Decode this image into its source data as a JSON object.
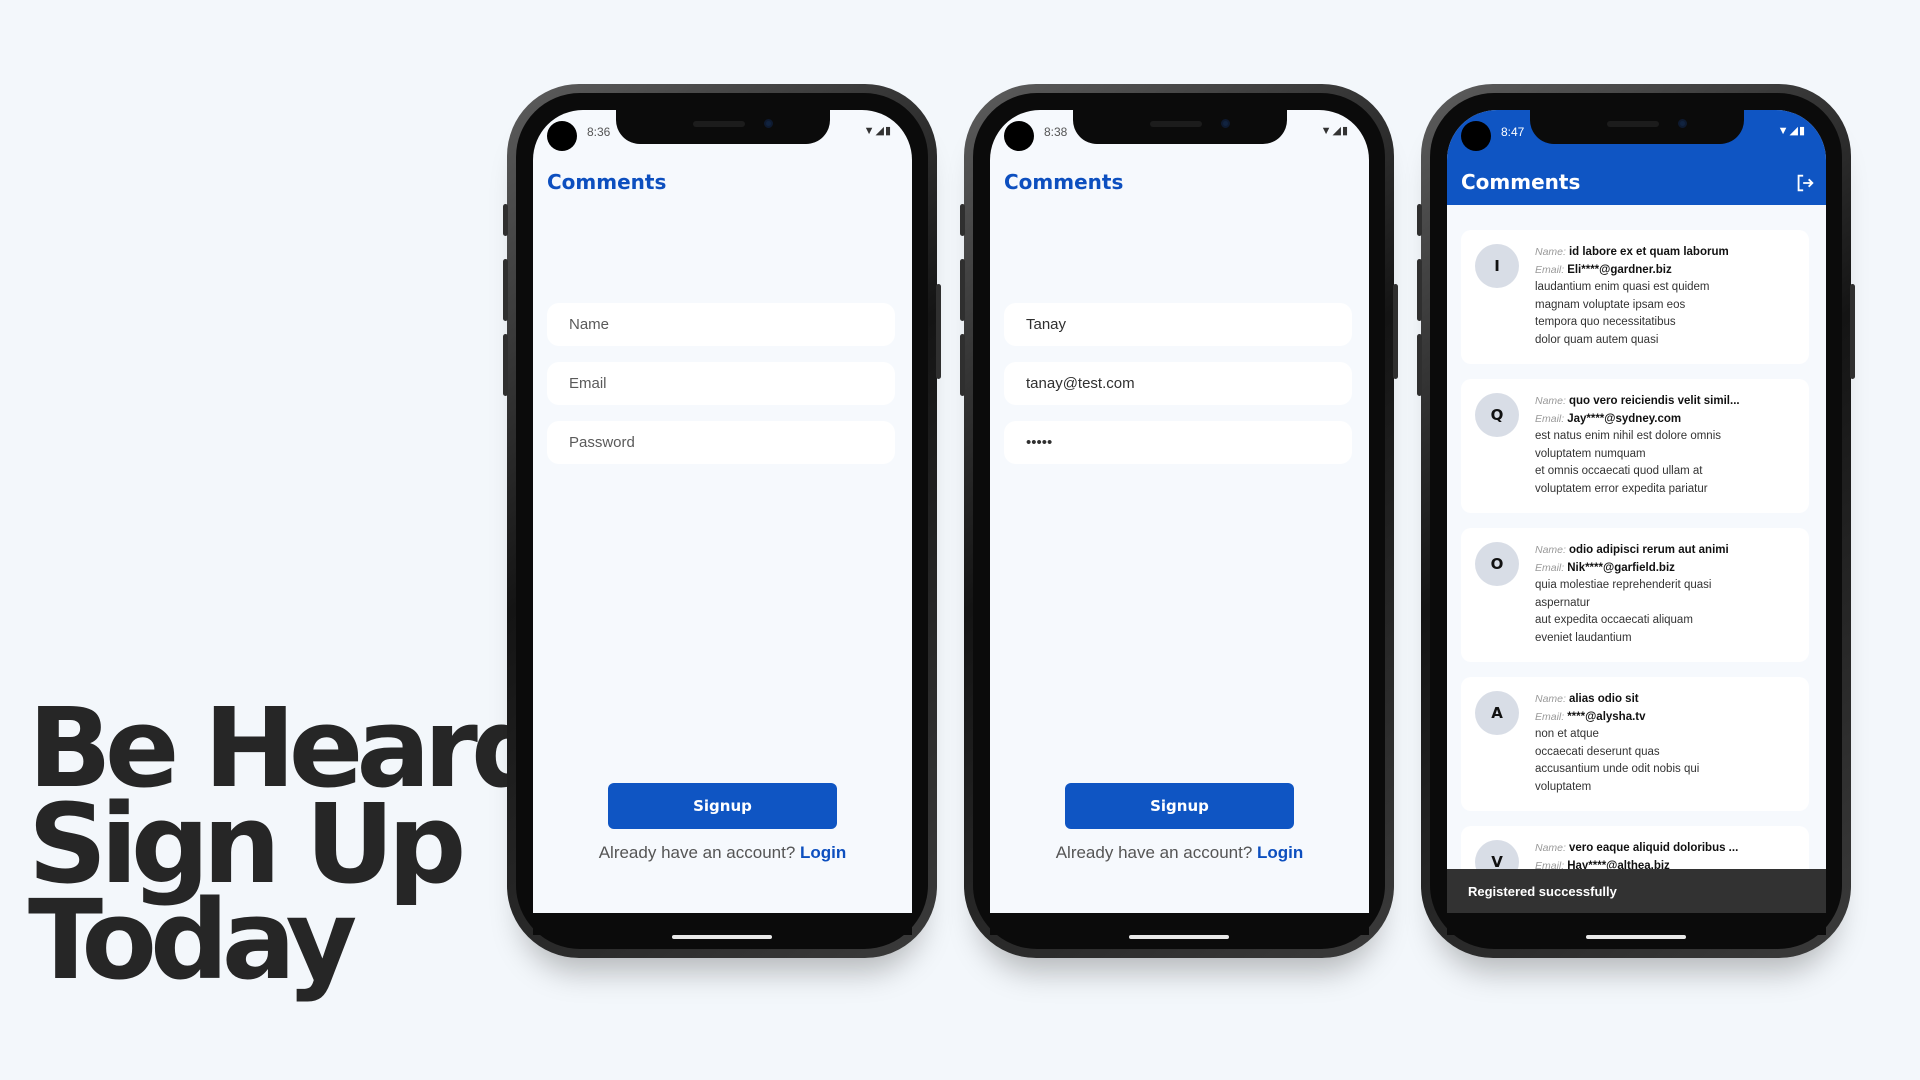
{
  "headline": [
    "Be Heard,",
    "Sign Up",
    "Today"
  ],
  "brand_color": "#0f55c3",
  "phones": [
    {
      "time": "8:36",
      "status_icons": "wifi-signal-battery",
      "title": "Comments",
      "fields": [
        {
          "placeholder": "Name",
          "value": ""
        },
        {
          "placeholder": "Email",
          "value": ""
        },
        {
          "placeholder": "Password",
          "value": ""
        }
      ],
      "signup_label": "Signup",
      "login_prompt": "Already have an account?",
      "login_link": "Login"
    },
    {
      "time": "8:38",
      "status_icons": "wifi-signal-battery",
      "title": "Comments",
      "fields": [
        {
          "placeholder": "Name",
          "value": "Tanay"
        },
        {
          "placeholder": "Email",
          "value": "tanay@test.com"
        },
        {
          "placeholder": "Password",
          "value": "•••••"
        }
      ],
      "signup_label": "Signup",
      "login_prompt": "Already have an account?",
      "login_link": "Login"
    },
    {
      "time": "8:47",
      "status_icons": "wifi-signal-battery",
      "title": "Comments",
      "logout_icon": "logout-icon",
      "name_label": "Name:",
      "email_label": "Email:",
      "comments": [
        {
          "initial": "I",
          "name": "id labore ex et quam laborum",
          "email": "Eli****@gardner.biz",
          "body": [
            "laudantium enim quasi est quidem",
            "magnam voluptate ipsam eos",
            "tempora quo necessitatibus",
            "dolor quam autem quasi"
          ]
        },
        {
          "initial": "Q",
          "name": "quo vero reiciendis velit simil...",
          "email": "Jay****@sydney.com",
          "body": [
            "est natus enim nihil est dolore omnis",
            "voluptatem numquam",
            "et omnis occaecati quod ullam at",
            "voluptatem error expedita pariatur"
          ]
        },
        {
          "initial": "O",
          "name": "odio adipisci rerum aut animi",
          "email": "Nik****@garfield.biz",
          "body": [
            "quia molestiae reprehenderit quasi",
            "aspernatur",
            "aut expedita occaecati aliquam",
            "eveniet laudantium"
          ]
        },
        {
          "initial": "A",
          "name": "alias odio sit",
          "email": "****@alysha.tv",
          "body": [
            "non et atque",
            "occaecati deserunt quas",
            "accusantium unde odit nobis qui",
            "voluptatem"
          ]
        },
        {
          "initial": "V",
          "name": "vero eaque aliquid doloribus ...",
          "email": "Hay****@althea.biz",
          "body": []
        }
      ],
      "snackbar": "Registered successfully"
    }
  ]
}
